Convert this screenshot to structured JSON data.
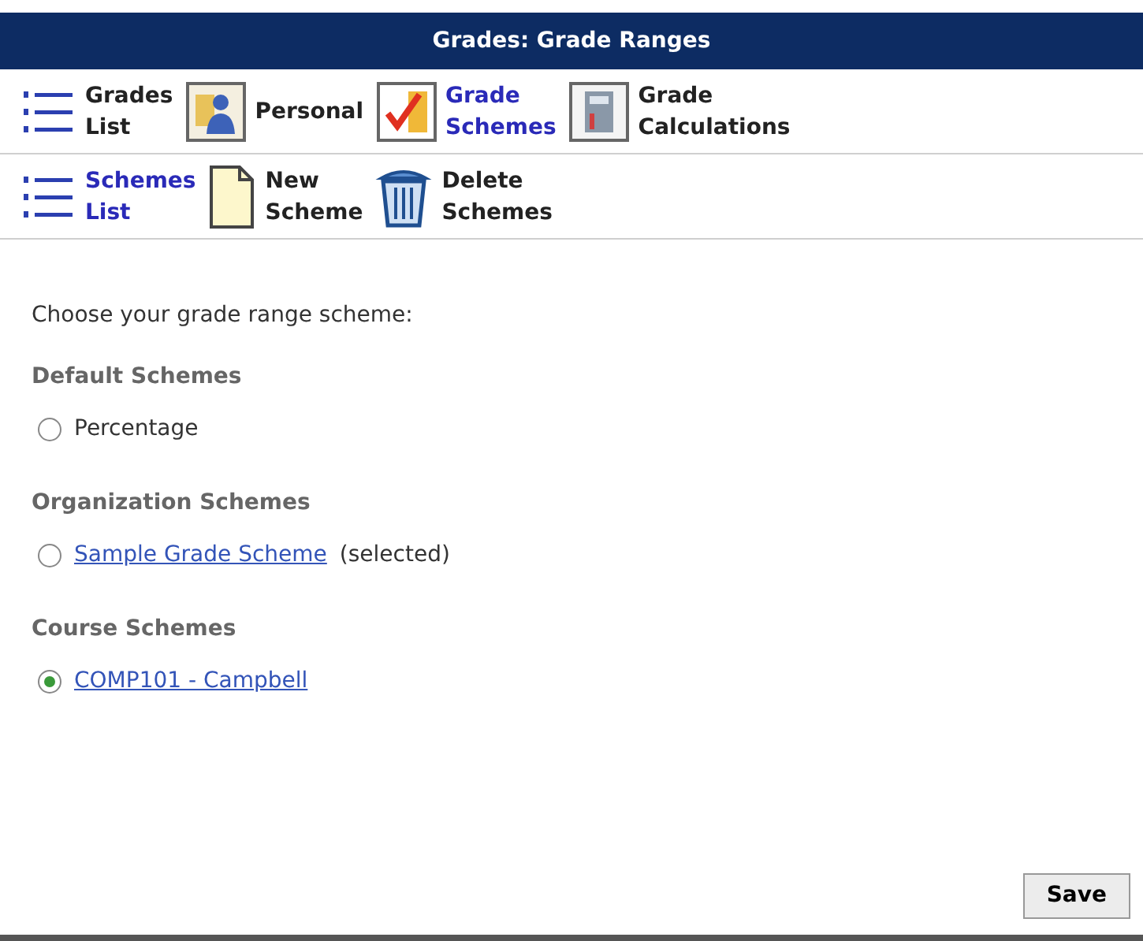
{
  "window": {
    "title": "Grades: Grade Ranges"
  },
  "toolbars": [
    [
      {
        "kind": "list",
        "lines": [
          "Grades",
          "List"
        ],
        "selected": false
      },
      {
        "kind": "person",
        "lines": [
          "Personal"
        ],
        "selected": false
      },
      {
        "kind": "grade",
        "lines": [
          "Grade",
          "Schemes"
        ],
        "selected": true
      },
      {
        "kind": "calc",
        "lines": [
          "Grade",
          "Calculations"
        ],
        "selected": false
      }
    ],
    [
      {
        "kind": "list",
        "lines": [
          "Schemes",
          "List"
        ],
        "selected": true
      },
      {
        "kind": "page",
        "lines": [
          "New",
          "Scheme"
        ],
        "selected": false
      },
      {
        "kind": "trash",
        "lines": [
          "Delete",
          "Schemes"
        ],
        "selected": false
      }
    ]
  ],
  "prompt": "Choose your grade range scheme:",
  "sections": [
    {
      "title": "Default Schemes",
      "options": [
        {
          "label": "Percentage",
          "link": false,
          "selected": false
        }
      ]
    },
    {
      "title": "Organization Schemes",
      "options": [
        {
          "label": "Sample Grade Scheme",
          "link": true,
          "note": "(selected)",
          "selected": false
        }
      ]
    },
    {
      "title": "Course Schemes",
      "options": [
        {
          "label": "COMP101 - Campbell",
          "link": true,
          "selected": true
        }
      ]
    }
  ],
  "save_button": "Save"
}
